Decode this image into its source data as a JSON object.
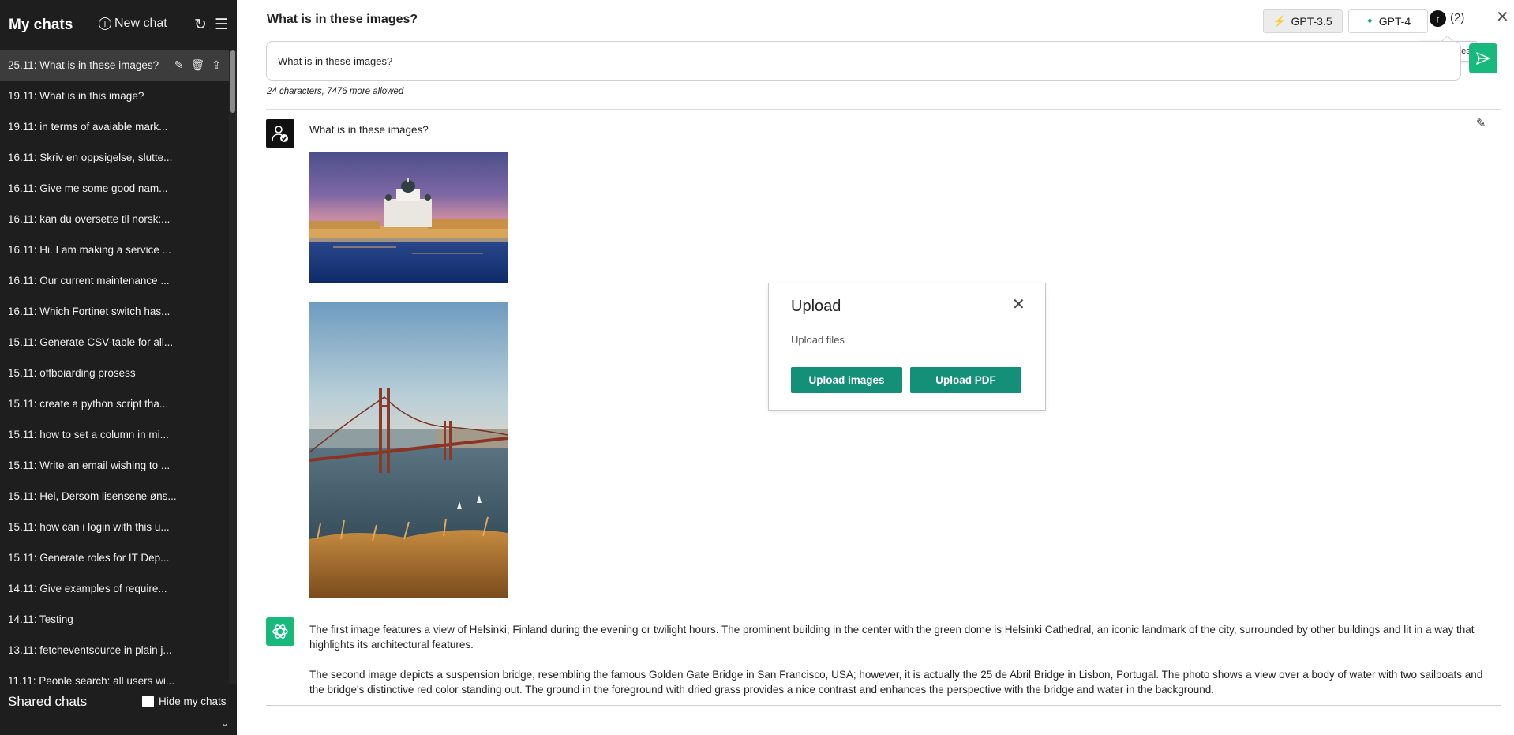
{
  "sidebar": {
    "title": "My chats",
    "new_chat_label": "New chat",
    "refresh_icon": "refresh-icon",
    "menu_icon": "menu-icon",
    "items": [
      {
        "label": "25.11: What is in these images?"
      },
      {
        "label": "19.11: What is in this image?"
      },
      {
        "label": "19.11: in terms of avaiable mark..."
      },
      {
        "label": "16.11: Skriv en oppsigelse, slutte..."
      },
      {
        "label": "16.11: Give me some good nam..."
      },
      {
        "label": "16.11: kan du oversette til norsk:..."
      },
      {
        "label": "16.11: Hi. I am making a service ..."
      },
      {
        "label": "16.11: Our current maintenance ..."
      },
      {
        "label": "16.11: Which Fortinet switch has..."
      },
      {
        "label": "15.11: Generate CSV-table for all..."
      },
      {
        "label": "15.11: offboiarding prosess"
      },
      {
        "label": "15.11: create a python script tha..."
      },
      {
        "label": "15.11: how to set a column in mi..."
      },
      {
        "label": "15.11: Write an email wishing to ..."
      },
      {
        "label": "15.11: Hei, Dersom lisensene øns..."
      },
      {
        "label": "15.11: how can i login with this u..."
      },
      {
        "label": "15.11: Generate roles for IT Dep..."
      },
      {
        "label": "14.11: Give examples of require..."
      },
      {
        "label": "14.11: Testing"
      },
      {
        "label": "13.11: fetcheventsource in plain j..."
      },
      {
        "label": "11.11: People search: all users wi..."
      }
    ],
    "shared_title": "Shared chats",
    "hide_mine_label": "Hide my chats"
  },
  "header": {
    "title": "What is in these images?",
    "model_35": "GPT-3.5",
    "model_4": "GPT-4",
    "upload_count": "(2)",
    "tooltip": "Upload files"
  },
  "prompt": {
    "value": "What is in these images?",
    "char_info": "24 characters, 7476 more allowed"
  },
  "messages": {
    "user_text": "What is in these images?",
    "ai_paragraph_1": "The first image features a view of Helsinki, Finland during the evening or twilight hours. The prominent building in the center with the green dome is Helsinki Cathedral, an iconic landmark of the city, surrounded by other buildings and lit in a way that highlights its architectural features.",
    "ai_paragraph_2": "The second image depicts a suspension bridge, resembling the famous Golden Gate Bridge in San Francisco, USA; however, it is actually the 25 de Abril Bridge in Lisbon, Portugal. The photo shows a view over a body of water with two sailboats and the bridge's distinctive red color standing out. The ground in the foreground with dried grass provides a nice contrast and enhances the perspective with the bridge and water in the background."
  },
  "dialog": {
    "title": "Upload",
    "subtitle": "Upload files",
    "btn_images": "Upload images",
    "btn_pdf": "Upload PDF"
  },
  "colors": {
    "sidebar_bg": "#1e1e1e",
    "active_item_bg": "#3c3c3c",
    "accent_green": "#19b87c",
    "dialog_button": "#148f78"
  }
}
